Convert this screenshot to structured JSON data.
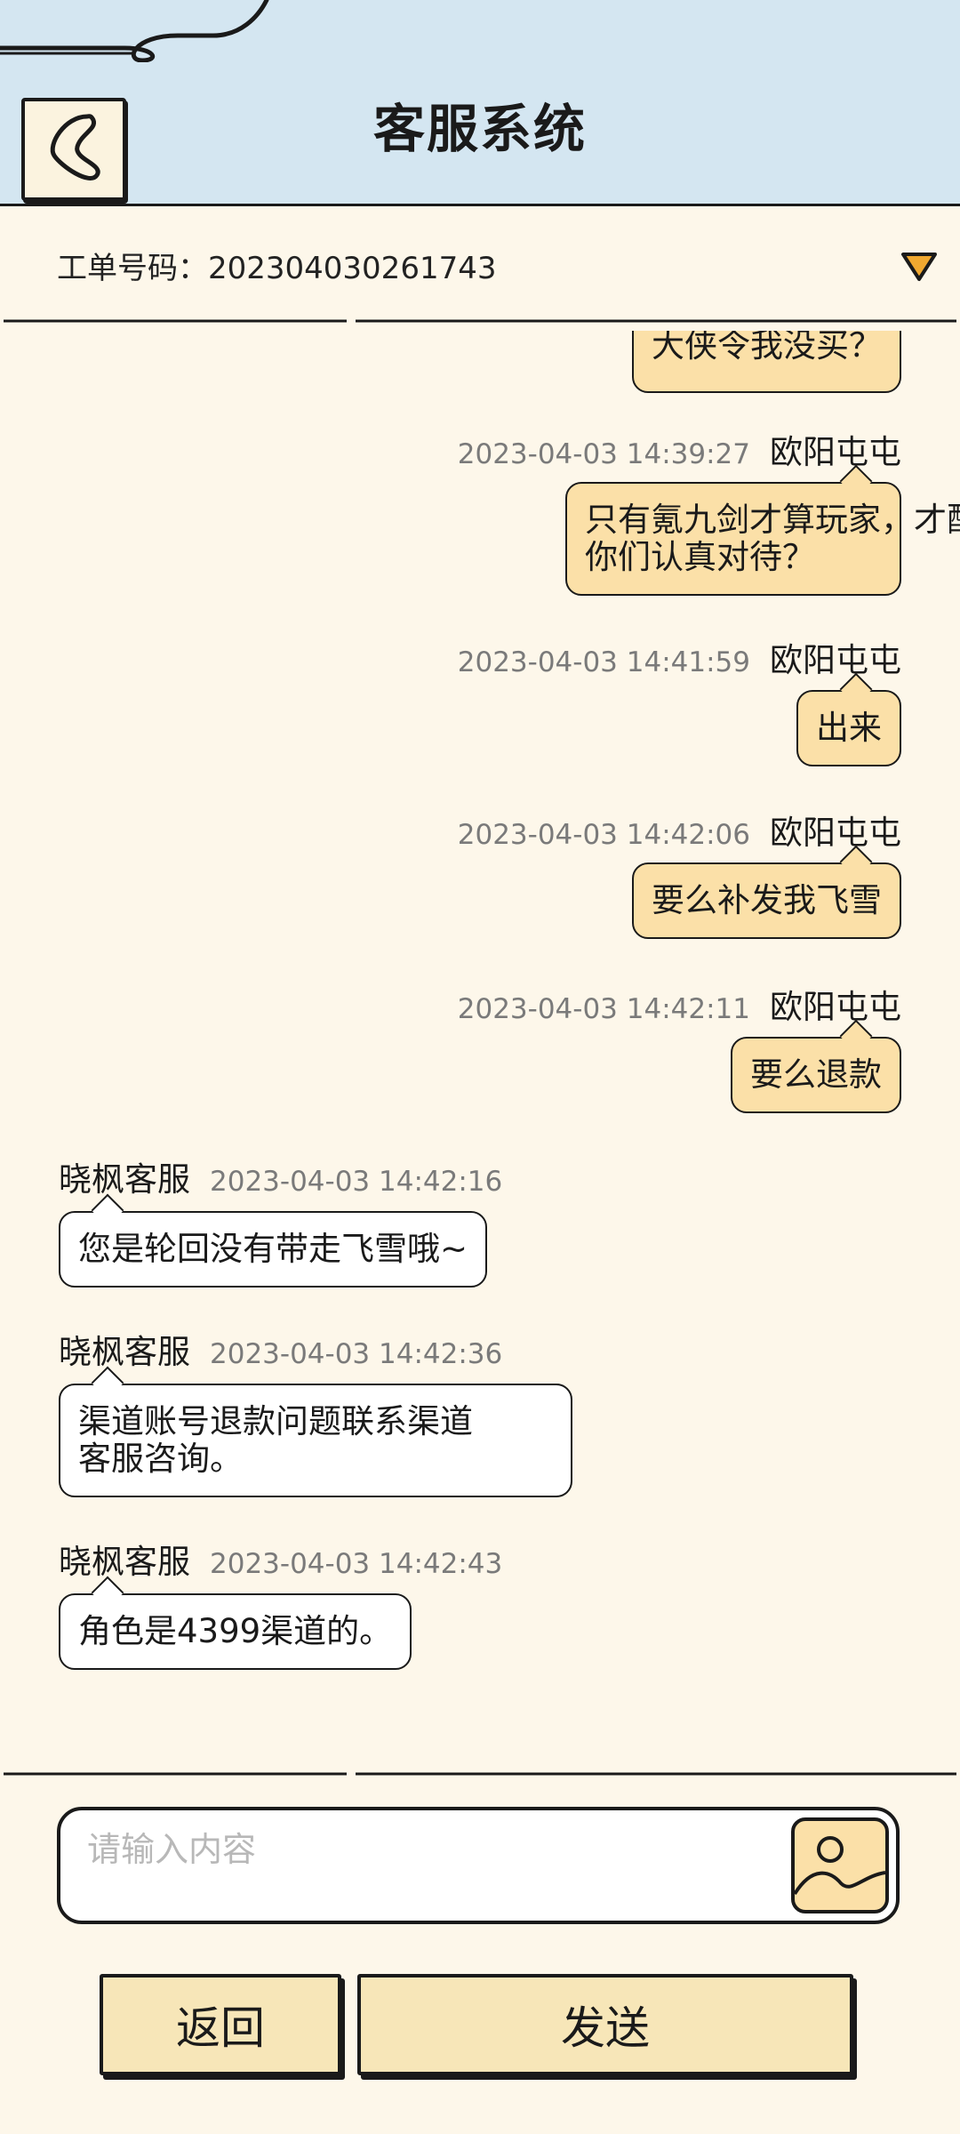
{
  "header": {
    "title": "客服系统",
    "back_icon": "chevron-left-icon"
  },
  "ticket": {
    "label": "工单号码：202304030261743",
    "dropdown_icon": "triangle-down-icon"
  },
  "messages": [
    {
      "side": "out",
      "text_lines": [
        "大侠令我没买？"
      ]
    },
    {
      "side": "out",
      "time": "2023-04-03 14:39:27",
      "name": "欧阳屯屯",
      "text_lines": [
        "只有氪九剑才算玩家，才配",
        "你们认真对待？"
      ]
    },
    {
      "side": "out",
      "time": "2023-04-03 14:41:59",
      "name": "欧阳屯屯",
      "text_lines": [
        "出来"
      ]
    },
    {
      "side": "out",
      "time": "2023-04-03 14:42:06",
      "name": "欧阳屯屯",
      "text_lines": [
        "要么补发我飞雪"
      ]
    },
    {
      "side": "out",
      "time": "2023-04-03 14:42:11",
      "name": "欧阳屯屯",
      "text_lines": [
        "要么退款"
      ]
    },
    {
      "side": "in",
      "name": "晓枫客服",
      "time": "2023-04-03 14:42:16",
      "text_lines": [
        "您是轮回没有带走飞雪哦~"
      ]
    },
    {
      "side": "in",
      "name": "晓枫客服",
      "time": "2023-04-03 14:42:36",
      "text_lines": [
        "渠道账号退款问题联系渠道",
        "客服咨询。"
      ]
    },
    {
      "side": "in",
      "name": "晓枫客服",
      "time": "2023-04-03 14:42:43",
      "text_lines": [
        "角色是4399渠道的。"
      ]
    }
  ],
  "input": {
    "placeholder": "请输入内容",
    "value": "",
    "image_icon": "image-icon"
  },
  "buttons": {
    "return_label": "返回",
    "send_label": "发送"
  },
  "colors": {
    "header_bg": "#d4e6f1",
    "page_bg": "#fdf7ea",
    "out_bubble": "#fbe0a8",
    "in_bubble": "#ffffff",
    "button_bg": "#f7e6b8",
    "dropdown_arrow": "#f0a830"
  }
}
